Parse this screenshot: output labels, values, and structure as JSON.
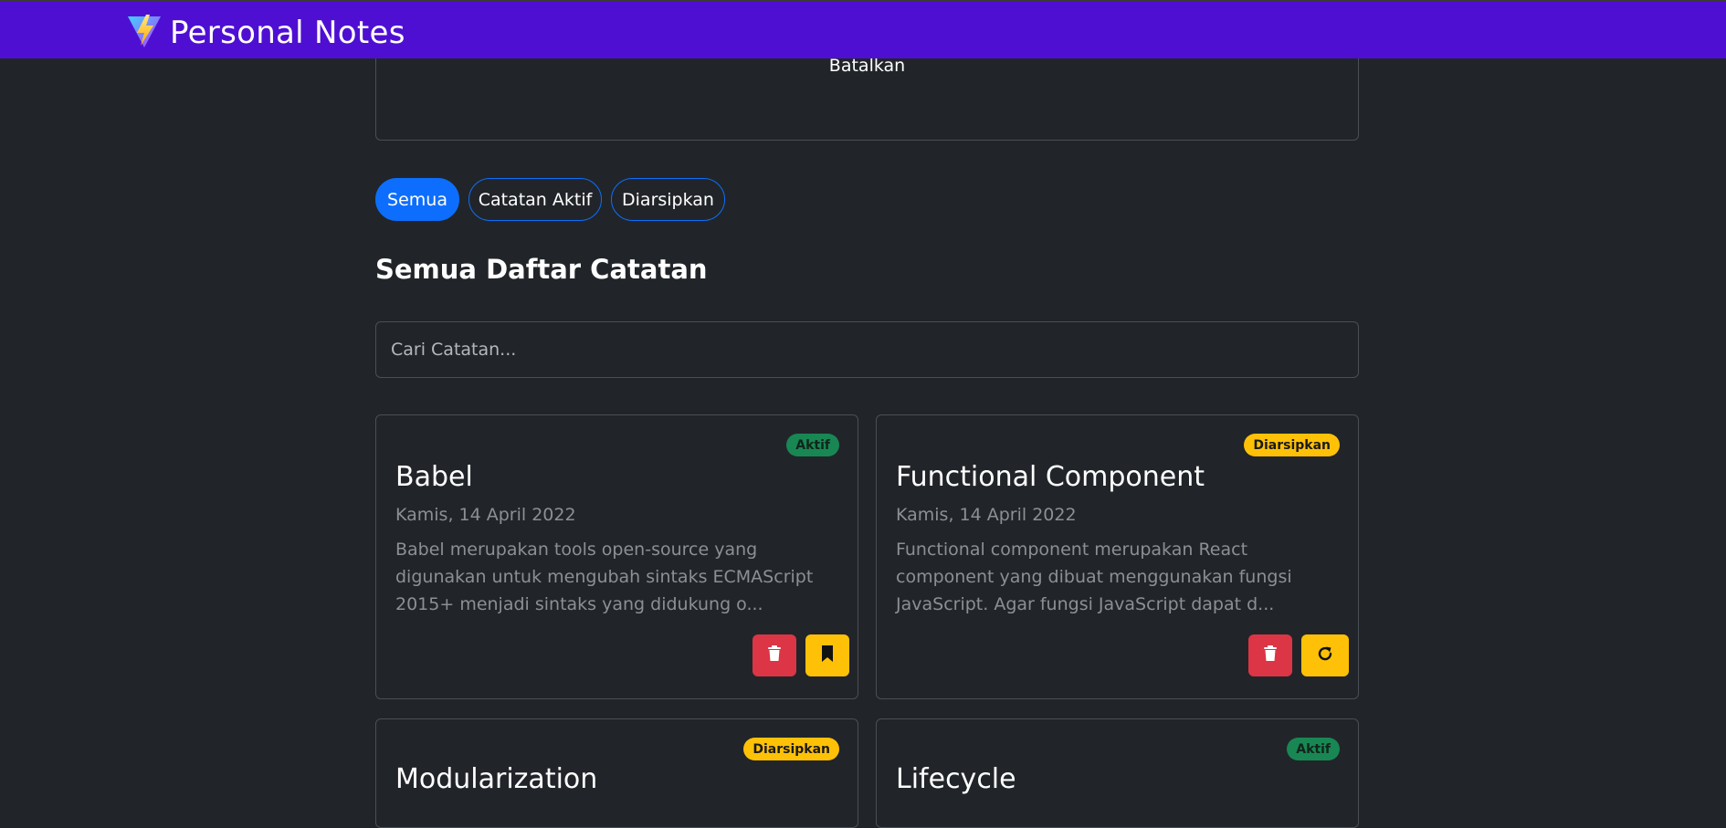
{
  "app": {
    "title": "Personal Notes"
  },
  "form": {
    "cancel_label": "Batalkan"
  },
  "filters": [
    {
      "label": "Semua",
      "active": true
    },
    {
      "label": "Catatan Aktif",
      "active": false
    },
    {
      "label": "Diarsipkan",
      "active": false
    }
  ],
  "section": {
    "title": "Semua Daftar Catatan"
  },
  "search": {
    "placeholder": "Cari Catatan...",
    "value": ""
  },
  "notes": [
    {
      "title": "Babel",
      "date": "Kamis, 14 April 2022",
      "body": "Babel merupakan tools open-source yang digunakan untuk mengubah sintaks ECMAScript 2015+ menjadi sintaks yang didukung o...",
      "status": "Aktif",
      "actions": [
        "trash-icon",
        "bookmark-icon"
      ]
    },
    {
      "title": "Functional Component",
      "date": "Kamis, 14 April 2022",
      "body": "Functional component merupakan React component yang dibuat menggunakan fungsi JavaScript. Agar fungsi JavaScript dapat d...",
      "status": "Diarsipkan",
      "actions": [
        "trash-icon",
        "restore-icon"
      ]
    },
    {
      "title": "Modularization",
      "status": "Diarsipkan"
    },
    {
      "title": "Lifecycle",
      "status": "Aktif"
    }
  ],
  "colors": {
    "navbar": "#4f0fd3",
    "background": "#212529",
    "primary": "#0d6efd",
    "success": "#198754",
    "warning": "#ffc107",
    "danger": "#dc3545"
  }
}
